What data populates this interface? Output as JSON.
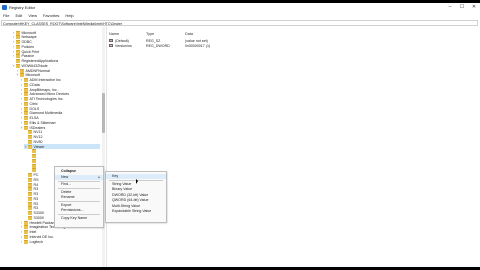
{
  "window": {
    "title": "Registry Editor"
  },
  "menu": [
    "File",
    "Edit",
    "View",
    "Favorites",
    "Help"
  ],
  "address": "Computer\\HKEY_CLASSES_ROOT\\Software\\Intel\\Media\\Intel\\HTC\\Dealer",
  "tree": [
    {
      "label": "Microsoft",
      "indent": 3,
      "chev": ">"
    },
    {
      "label": "Netscape",
      "indent": 3,
      "chev": ">"
    },
    {
      "label": "ODBC",
      "indent": 3,
      "chev": ">"
    },
    {
      "label": "Policies",
      "indent": 3,
      "chev": ">"
    },
    {
      "label": "Quick Print",
      "indent": 3,
      "chev": ">"
    },
    {
      "label": "Passive",
      "indent": 3,
      "chev": ">"
    },
    {
      "label": "RegisteredApplications",
      "indent": 3,
      "chev": ""
    },
    {
      "label": "WOW6432Node",
      "indent": 3,
      "chev": "v"
    },
    {
      "label": "AMDNFNormal",
      "indent": 4,
      "chev": ">"
    },
    {
      "label": "Microsoft",
      "indent": 4,
      "chev": "v"
    },
    {
      "label": "ADM Interactive Inc",
      "indent": 5,
      "chev": ">"
    },
    {
      "label": "CData",
      "indent": 5,
      "chev": ">"
    },
    {
      "label": "AmpBitmaps, Inc.",
      "indent": 5,
      "chev": ">"
    },
    {
      "label": "Advanced Micro Devices",
      "indent": 5,
      "chev": ">"
    },
    {
      "label": "ATI Technologies Inc.",
      "indent": 5,
      "chev": ">"
    },
    {
      "label": "Citrix",
      "indent": 5,
      "chev": ">"
    },
    {
      "label": "DOLS",
      "indent": 5,
      "chev": ">"
    },
    {
      "label": "Diamond Multimedia",
      "indent": 5,
      "chev": ">"
    },
    {
      "label": "ELSA",
      "indent": 5,
      "chev": ">"
    },
    {
      "label": "Ellis & Silkerbarr",
      "indent": 5,
      "chev": ">"
    },
    {
      "label": "ISDealers",
      "indent": 5,
      "chev": "v"
    },
    {
      "label": "NV11",
      "indent": 6,
      "chev": ""
    },
    {
      "label": "NV12",
      "indent": 6,
      "chev": ""
    },
    {
      "label": "NV80",
      "indent": 6,
      "chev": ""
    },
    {
      "label": "Viewer",
      "indent": 6,
      "chev": "v",
      "selected": true
    },
    {
      "label": "",
      "indent": 7,
      "chev": ""
    },
    {
      "label": "",
      "indent": 7,
      "chev": ""
    },
    {
      "label": "",
      "indent": 7,
      "chev": ""
    },
    {
      "label": "",
      "indent": 7,
      "chev": ""
    },
    {
      "label": "",
      "indent": 7,
      "chev": ""
    },
    {
      "label": "PC",
      "indent": 6,
      "chev": ""
    },
    {
      "label": "RS",
      "indent": 6,
      "chev": ""
    },
    {
      "label": "R4",
      "indent": 6,
      "chev": ""
    },
    {
      "label": "R3",
      "indent": 6,
      "chev": ""
    },
    {
      "label": "R3",
      "indent": 6,
      "chev": ""
    },
    {
      "label": "R3",
      "indent": 6,
      "chev": ""
    },
    {
      "label": "R3",
      "indent": 6,
      "chev": ""
    },
    {
      "label": "R3",
      "indent": 6,
      "chev": ""
    },
    {
      "label": "S3300",
      "indent": 6,
      "chev": ""
    },
    {
      "label": "S3000",
      "indent": 6,
      "chev": ""
    },
    {
      "label": "Hewlett Packard Company",
      "indent": 5,
      "chev": ">"
    },
    {
      "label": "Imagination Technologies",
      "indent": 5,
      "chev": ">"
    },
    {
      "label": "Intel",
      "indent": 5,
      "chev": ">"
    },
    {
      "label": "Intervid DE Inc.",
      "indent": 5,
      "chev": ">"
    },
    {
      "label": "Logitech",
      "indent": 5,
      "chev": ">"
    }
  ],
  "list": {
    "headers": {
      "name": "Name",
      "type": "Type",
      "data": "Data"
    },
    "rows": [
      {
        "icon": "ab",
        "name": "(Default)",
        "type": "REG_SZ",
        "data": "(value not set)"
      },
      {
        "icon": "01",
        "name": "Version/ns",
        "type": "REG_DWORD",
        "data": "0x00000017 (1)"
      }
    ]
  },
  "context_menu": {
    "items": [
      {
        "label": "Collapse",
        "bold": true
      },
      {
        "label": "New",
        "submenu": true,
        "highlight": true
      },
      {
        "label": "Find...",
        "sep_before": true
      },
      {
        "label": "Delete",
        "sep_before": true
      },
      {
        "label": "Rename"
      },
      {
        "label": "Export",
        "sep_before": true
      },
      {
        "label": "Permissions..."
      },
      {
        "label": "Copy Key Name",
        "sep_before": true
      }
    ]
  },
  "submenu": {
    "items": [
      {
        "label": "Key",
        "highlight": true
      },
      {
        "label": "String Value",
        "sep_before": true
      },
      {
        "label": "Binary Value"
      },
      {
        "label": "DWORD (32-bit) Value"
      },
      {
        "label": "QWORD (64-bit) Value"
      },
      {
        "label": "Multi-String Value"
      },
      {
        "label": "Expandable String Value"
      }
    ]
  },
  "window_buttons": {
    "min": "–",
    "max": "☐",
    "close": "✕"
  }
}
